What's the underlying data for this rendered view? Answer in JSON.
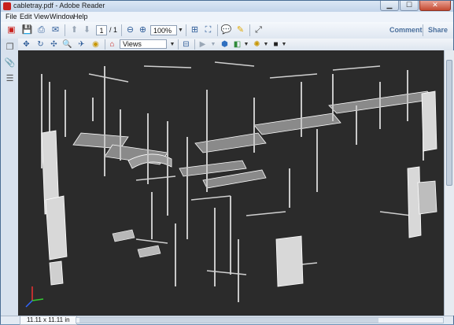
{
  "window": {
    "title": "cabletray.pdf - Adobe Reader"
  },
  "menu": [
    "File",
    "Edit",
    "View",
    "Window",
    "Help"
  ],
  "toolbar": {
    "page_current": "1",
    "page_total": "/ 1",
    "zoom": "100%",
    "comment_label": "Comment",
    "share_label": "Share"
  },
  "toolbar3d": {
    "views_label": "Views"
  },
  "status": {
    "page_size": "11.11 x 11.11 in"
  },
  "colors": {
    "viewport_bg": "#2b2b2b",
    "model_fill": "#d8d8d8",
    "model_edge": "#ffffff"
  }
}
